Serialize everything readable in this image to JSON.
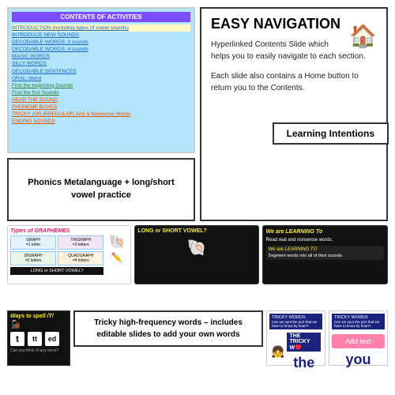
{
  "contents": {
    "header": "CONTENTS OF ACTIVITIES",
    "items": [
      {
        "text": "INTRODUCTION (Including types of vowel sounds)",
        "style": "yellow"
      },
      {
        "text": "INTRODUCE NEW SOUNDS",
        "style": "normal"
      },
      {
        "text": "DECODABLE WORDS: 3 sounds",
        "style": "normal"
      },
      {
        "text": "DECODABLE WORDS: 4 sounds",
        "style": "normal"
      },
      {
        "text": "MAGIC WORDS",
        "style": "normal"
      },
      {
        "text": "SILLY WORDS",
        "style": "normal"
      },
      {
        "text": "DECODABLE SENTENCES",
        "style": "normal"
      },
      {
        "text": "ORAL: blend",
        "style": "normal"
      },
      {
        "text": "Find the beginning Sounds",
        "style": "green"
      },
      {
        "text": "Find the first Sounds",
        "style": "green"
      },
      {
        "text": "HEAR THE SOUND",
        "style": "orange"
      },
      {
        "text": "PHONEME BOXES",
        "style": "orange"
      },
      {
        "text": "TRICKY (OR IRREGULAR) And & Nonsense Words",
        "style": "orange"
      },
      {
        "text": "ENDING SOUNDS",
        "style": "orange"
      }
    ]
  },
  "easy_nav": {
    "title": "EASY NAVIGATION",
    "para1": "Hyperlinked Contents Slide which helps you to easily navigate to each section.",
    "para2": "Each slide also contains a Home button to return you to the Contents.",
    "house_icon": "🏠"
  },
  "phonics": {
    "label": "Phonics Metalanguage +\nlong/short vowel practice"
  },
  "learning_intentions": {
    "label": "Learning Intentions",
    "slide1_header": "We are LEARNING To",
    "slide1_body": "Read real and nonsense words.",
    "slide2_header": "We are LEARNING TO",
    "slide2_body": "Segment words into all of their sounds."
  },
  "graphemes": {
    "title": "Types of GRAPHEMES",
    "long_short_label": "LONG or SHORT VOWEL?",
    "graph": "GRAPH\n=1 letter",
    "trigraph": "TRIGRAPH\n= 3 letters",
    "digraph": "DIGRAPH\n= 2 letters",
    "quadgraph": "QUADGRAPH\n= 4 letters"
  },
  "ways_to_spell": {
    "title": "Ways to spell /T/",
    "letters": [
      "t",
      "tt",
      "ed"
    ],
    "caption": "Can you think of any more?"
  },
  "tricky_words": {
    "label": "Tricky high-frequency words –\nincludes editable slides to\nadd your own words",
    "header": "TRICKY WORDS",
    "subheader": "Can we spot the part that we have to know by heart?",
    "word_the": "the",
    "word_you": "you",
    "add_text": "Add text",
    "tricky_word_label": "THE TRICKY W♥️"
  },
  "colors": {
    "purple_header": "#7c4dff",
    "light_blue_bg": "#b3e5fc",
    "dark_bg": "#111111",
    "navy": "#1a237e",
    "pink": "#e91e63",
    "yellow": "#ffeb3b"
  }
}
